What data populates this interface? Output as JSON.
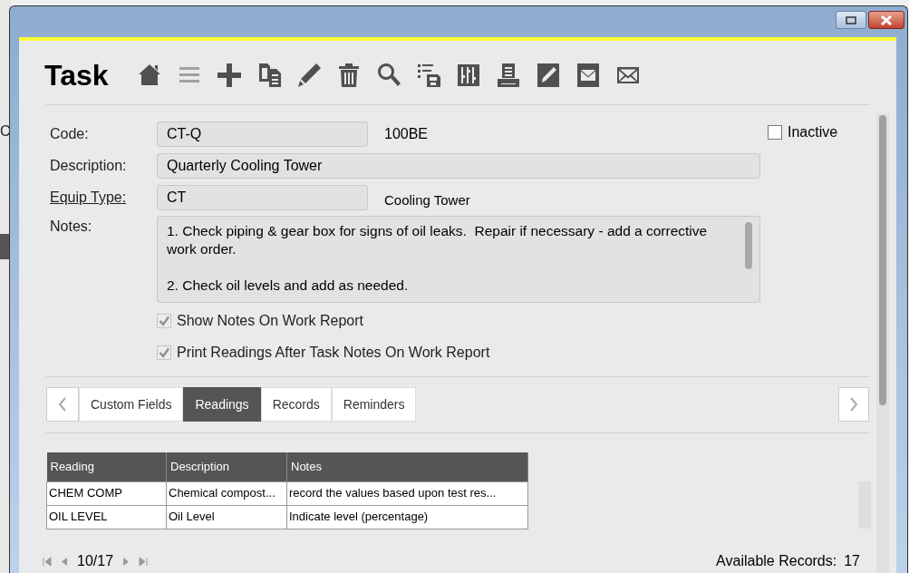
{
  "background_window": {
    "text": "C"
  },
  "header": {
    "title": "Task"
  },
  "toolbar": [
    {
      "kind": "home",
      "disabled": false
    },
    {
      "kind": "list",
      "disabled": true
    },
    {
      "kind": "add",
      "disabled": false
    },
    {
      "kind": "copy",
      "disabled": false
    },
    {
      "kind": "edit",
      "disabled": false
    },
    {
      "kind": "delete",
      "disabled": false
    },
    {
      "kind": "search",
      "disabled": false
    },
    {
      "kind": "listsave",
      "disabled": false
    },
    {
      "kind": "sliders",
      "disabled": false
    },
    {
      "kind": "print",
      "disabled": false
    },
    {
      "kind": "editbox",
      "disabled": false
    },
    {
      "kind": "mailbox",
      "disabled": false
    },
    {
      "kind": "mail",
      "disabled": false
    }
  ],
  "form": {
    "code": {
      "label": "Code:",
      "value": "CT-Q",
      "extra": "100BE"
    },
    "inactive": {
      "label": "Inactive",
      "checked": false
    },
    "description": {
      "label": "Description:",
      "value": "Quarterly Cooling Tower"
    },
    "equip_type": {
      "label": "Equip Type:",
      "value": "CT",
      "extra": "Cooling Tower"
    },
    "notes": {
      "label": "Notes:",
      "value": "1. Check piping & gear box for signs of oil leaks.  Repair if necessary - add a corrective work order.\n\n2. Check oil levels and add as needed."
    },
    "options": [
      {
        "label": "Show Notes On Work Report",
        "checked": true,
        "disabled": true
      },
      {
        "label": "Print Readings After Task Notes On Work Report",
        "checked": true,
        "disabled": true
      }
    ]
  },
  "tabs": [
    {
      "label": "Custom Fields",
      "selected": false
    },
    {
      "label": "Readings",
      "selected": true
    },
    {
      "label": "Records",
      "selected": false
    },
    {
      "label": "Reminders",
      "selected": false
    }
  ],
  "table": {
    "columns": [
      "Reading",
      "Description",
      "Notes"
    ],
    "rows": [
      [
        "CHEM COMP",
        "Chemical compost...",
        "record the values based upon test res..."
      ],
      [
        "OIL LEVEL",
        "Oil Level",
        "Indicate level (percentage)"
      ]
    ]
  },
  "footer": {
    "position": "10/17",
    "available_label": "Available Records:",
    "available_count": "17"
  }
}
